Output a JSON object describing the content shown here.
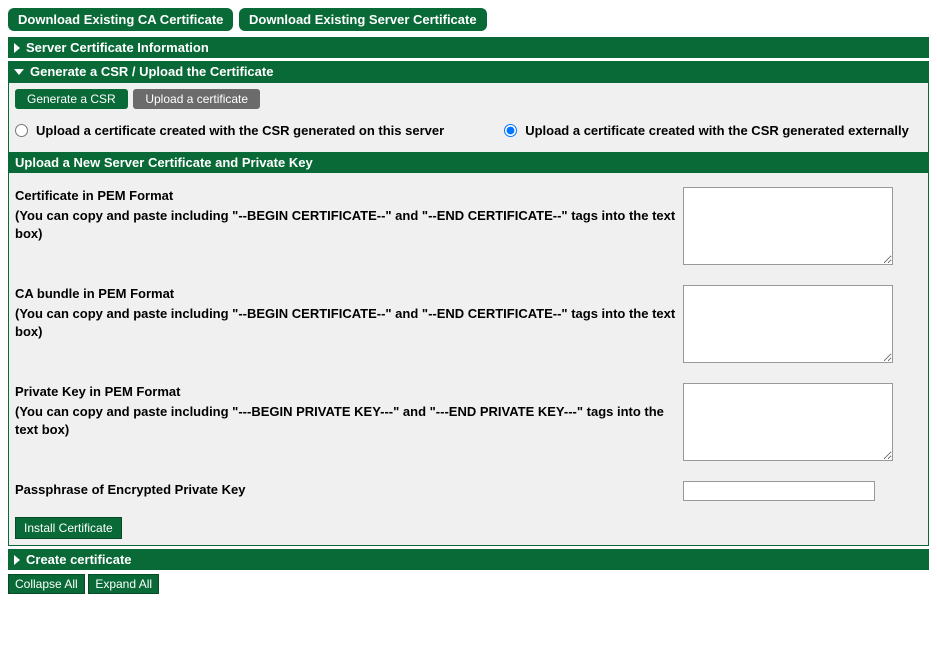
{
  "top_buttons": {
    "download_ca": "Download Existing CA Certificate",
    "download_server": "Download Existing Server Certificate"
  },
  "sections": {
    "server_info": "Server Certificate Information",
    "generate_upload": "Generate a CSR / Upload the Certificate",
    "create_cert": "Create certificate"
  },
  "tabs": {
    "generate": "Generate a CSR",
    "upload": "Upload a certificate"
  },
  "radios": {
    "opt_this_server": "Upload a certificate created with the CSR generated on this server",
    "opt_external": "Upload a certificate created with the CSR generated externally"
  },
  "subheader": "Upload a New Server Certificate and Private Key",
  "fields": {
    "cert": {
      "label": "Certificate in PEM Format",
      "hint": "(You can copy and paste including \"--BEGIN CERTIFICATE--\" and \"--END CERTIFICATE--\" tags into the text box)"
    },
    "cabundle": {
      "label": "CA bundle in PEM Format",
      "hint": "(You can copy and paste including \"--BEGIN CERTIFICATE--\" and \"--END CERTIFICATE--\" tags into the text box)"
    },
    "privkey": {
      "label": "Private Key in PEM Format",
      "hint": "(You can copy and paste including \"---BEGIN PRIVATE KEY---\" and \"---END PRIVATE KEY---\" tags into the text box)"
    },
    "passphrase": {
      "label": "Passphrase of Encrypted Private Key"
    }
  },
  "buttons": {
    "install": "Install Certificate",
    "collapse": "Collapse All",
    "expand": "Expand All"
  }
}
